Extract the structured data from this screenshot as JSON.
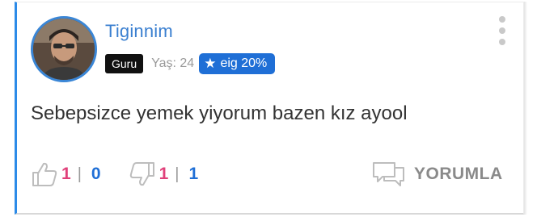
{
  "post": {
    "username": "Tiginnim",
    "rank_badge": "Guru",
    "age_label": "Yaş: 24",
    "eig_badge": {
      "icon": "star-icon",
      "label": "eig 20%"
    },
    "message": "Sebepsizce yemek yiyorum bazen kız ayool"
  },
  "actions": {
    "like": {
      "icon": "thumbs-up-icon",
      "count_pink": "1",
      "separator": "|",
      "count_blue": "0"
    },
    "dislike": {
      "icon": "thumbs-down-icon",
      "count_pink": "1",
      "separator": "|",
      "count_blue": "1"
    },
    "comment": {
      "icon": "comment-icon",
      "label": "YORUMLA"
    }
  },
  "colors": {
    "accent_blue": "#1f6fd6",
    "username_blue": "#3a7fd0",
    "pink": "#e0407a",
    "rank_badge_bg": "#111111",
    "card_left_border": "#2c8be8"
  }
}
